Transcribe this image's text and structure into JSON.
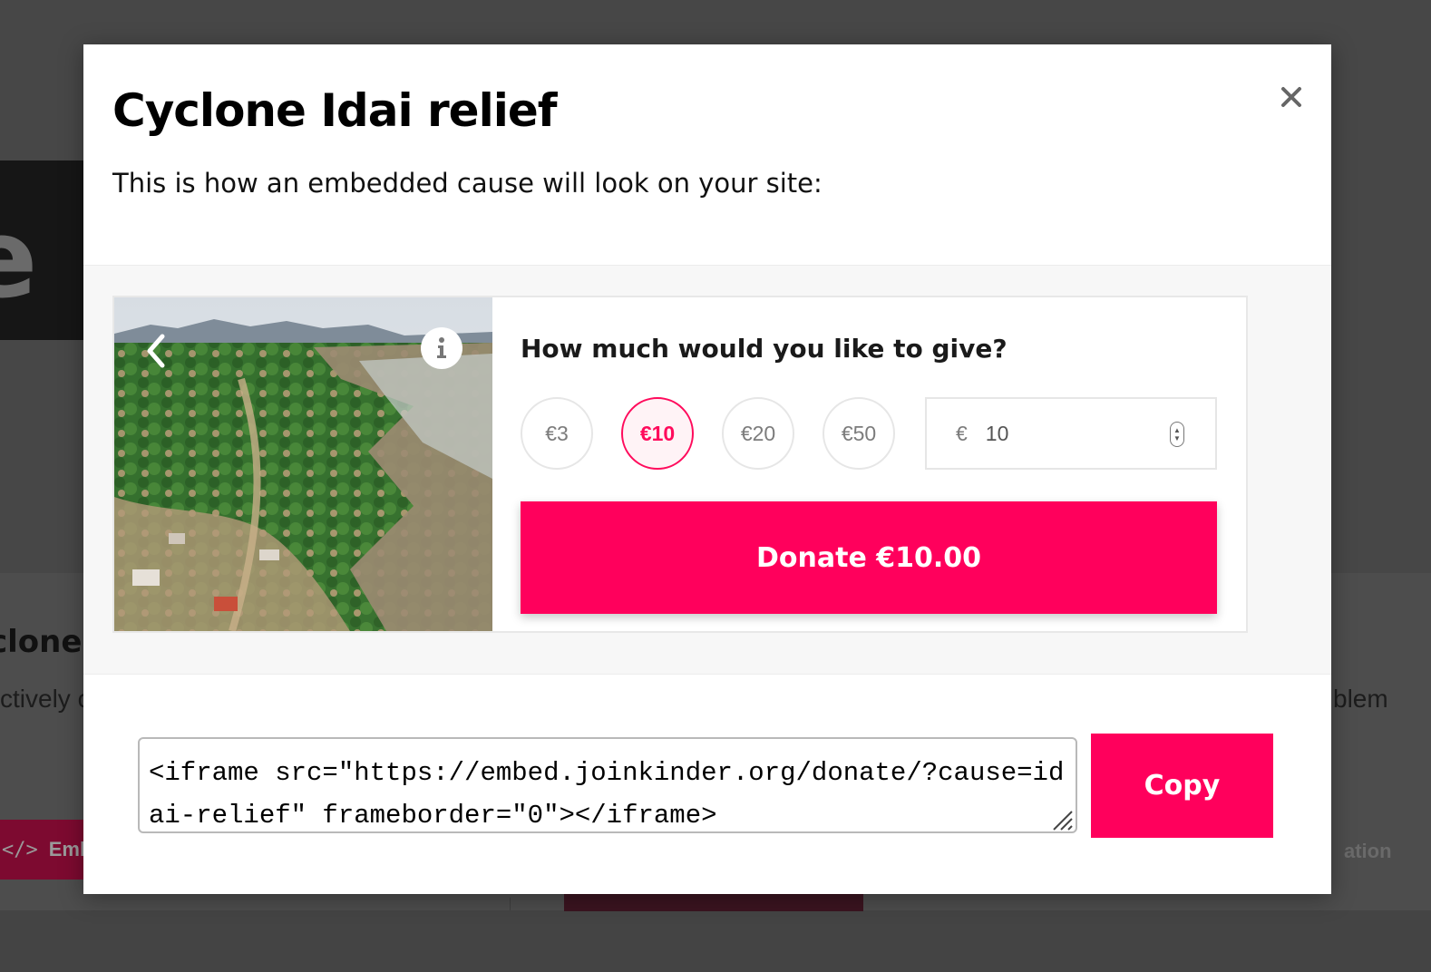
{
  "background_page": {
    "hero_text": "e e",
    "card_title": "clone",
    "card_text_left": "ctively c",
    "card_text_right": "blem",
    "embed_button_icon": "</>",
    "embed_button_label": "Emb",
    "right_button_label": "ation"
  },
  "modal": {
    "title": "Cyclone Idai relief",
    "close_icon": "close-icon",
    "subtitle": "This is how an embedded cause will look on your site:"
  },
  "widget": {
    "photo_description_icon": "info-icon",
    "prev_icon": "chevron-left-icon",
    "question": "How much would you like to give?",
    "amounts": [
      "€3",
      "€10",
      "€20",
      "€50"
    ],
    "selected_amount": "€10",
    "custom_currency": "€",
    "custom_value": "10",
    "donate_label": "Donate €10.00",
    "accent_color": "#ff005c"
  },
  "embed": {
    "code": "<iframe src=\"https://embed.joinkinder.org/donate/?cause=idai-relief\" frameborder=\"0\"></iframe>",
    "copy_label": "Copy"
  }
}
